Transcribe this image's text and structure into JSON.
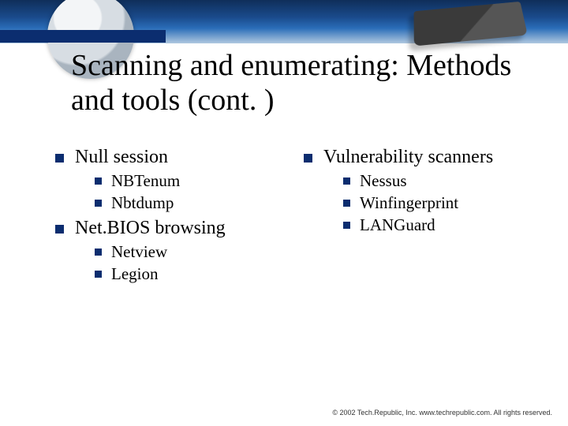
{
  "title": "Scanning and enumerating: Methods and tools (cont. )",
  "left": {
    "items": [
      {
        "label": "Null session",
        "sub": [
          "NBTenum",
          "Nbtdump"
        ]
      },
      {
        "label": "Net.BIOS browsing",
        "sub": [
          "Netview",
          "Legion"
        ]
      }
    ]
  },
  "right": {
    "items": [
      {
        "label": "Vulnerability scanners",
        "sub": [
          "Nessus",
          "Winfingerprint",
          "LANGuard"
        ]
      }
    ]
  },
  "footer": "© 2002 Tech.Republic, Inc. www.techrepublic.com. All rights reserved."
}
